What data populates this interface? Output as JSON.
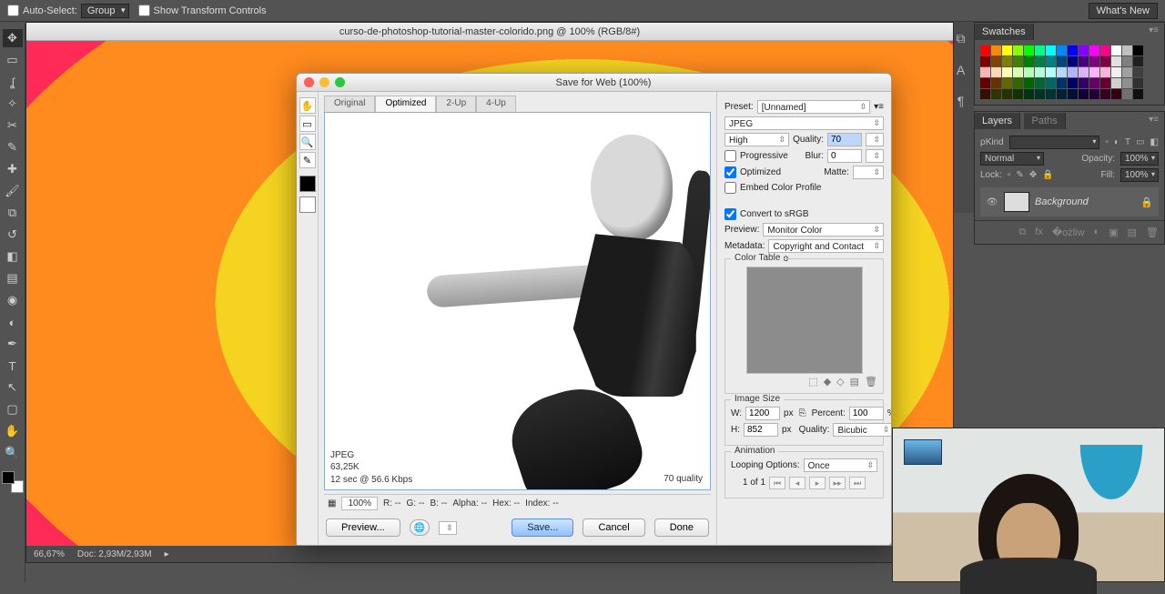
{
  "options_bar": {
    "auto_select_label": "Auto-Select:",
    "auto_select_value": "Group",
    "show_transform": "Show Transform Controls",
    "whats_new": "What's New"
  },
  "document": {
    "title": "curso-de-photoshop-tutorial-master-colorido.png @ 100% (RGB/8#)",
    "status_zoom": "66,67%",
    "status_doc": "Doc: 2,93M/2,93M"
  },
  "panels": {
    "swatches_tab": "Swatches",
    "layers_tab": "Layers",
    "paths_tab": "Paths",
    "kind_label": "ρKind",
    "blend_mode": "Normal",
    "opacity_label": "Opacity:",
    "opacity_value": "100%",
    "lock_label": "Lock:",
    "fill_label": "Fill:",
    "fill_value": "100%",
    "layer_name": "Background"
  },
  "sfw": {
    "title": "Save for Web (100%)",
    "tabs": {
      "original": "Original",
      "optimized": "Optimized",
      "two_up": "2-Up",
      "four_up": "4-Up"
    },
    "meta_format": "JPEG",
    "meta_size": "63,25K",
    "meta_time": "12 sec @ 56.6 Kbps",
    "meta_quality_r": "70 quality",
    "readout": {
      "zoom": "100%",
      "r": "R: --",
      "g": "G: --",
      "b": "B: --",
      "alpha": "Alpha: --",
      "hex": "Hex: --",
      "index": "Index: --"
    },
    "buttons": {
      "preview": "Preview...",
      "save": "Save...",
      "cancel": "Cancel",
      "done": "Done"
    },
    "settings": {
      "preset_label": "Preset:",
      "preset_value": "[Unnamed]",
      "format": "JPEG",
      "comp": "High",
      "quality_label": "Quality:",
      "quality_value": "70",
      "progressive": "Progressive",
      "blur_label": "Blur:",
      "blur_value": "0",
      "optimized": "Optimized",
      "matte_label": "Matte:",
      "embed_profile": "Embed Color Profile",
      "convert_srgb": "Convert to sRGB",
      "preview_label": "Preview:",
      "preview_value": "Monitor Color",
      "metadata_label": "Metadata:",
      "metadata_value": "Copyright and Contact Info",
      "color_table": "Color Table",
      "image_size": "Image Size",
      "w_label": "W:",
      "w_value": "1200",
      "px": "px",
      "h_label": "H:",
      "h_value": "852",
      "percent_label": "Percent:",
      "percent_value": "100",
      "percent_unit": "%",
      "quality2_label": "Quality:",
      "quality2_value": "Bicubic",
      "animation": "Animation",
      "looping_label": "Looping Options:",
      "looping_value": "Once",
      "frame": "1 of 1"
    }
  }
}
